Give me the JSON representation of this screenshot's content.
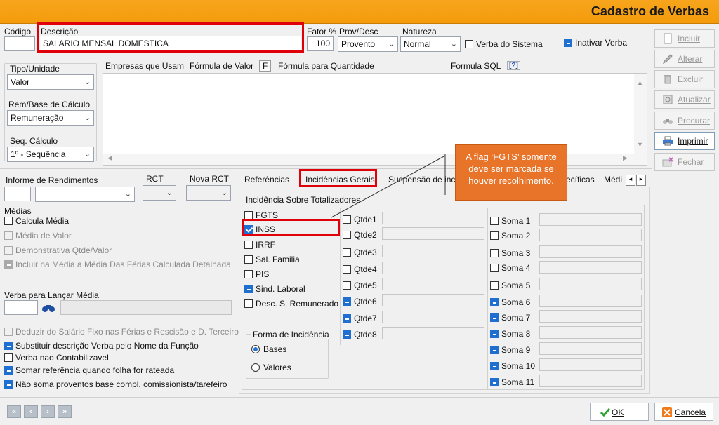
{
  "window": {
    "title": "Cadastro de Verbas"
  },
  "header": {
    "codigo_label": "Código",
    "descricao_label": "Descrição",
    "descricao_value": "SALARIO MENSAL DOMESTICA",
    "fator_label": "Fator %",
    "fator_value": "100",
    "provdesc_label": "Prov/Desc",
    "provdesc_value": "Provento",
    "natureza_label": "Natureza",
    "natureza_value": "Normal",
    "verba_sistema_label": "Verba do Sistema",
    "inativar_label": "Inativar Verba"
  },
  "left_top": {
    "tipo_label": "Tipo/Unidade",
    "tipo_value": "Valor",
    "rem_label": "Rem/Base de Cálculo",
    "rem_value": "Remuneração",
    "seq_label": "Seq. Cálculo",
    "seq_value": "1º - Sequência"
  },
  "top_tabs": {
    "empresas": "Empresas que Usam",
    "formula_valor": "Fórmula de Valor",
    "f_btn": "F",
    "formula_qtd": "Fórmula para Quantidade",
    "formula_sql": "Formula SQL",
    "sql_help": "[?]"
  },
  "side_buttons": [
    {
      "label": "Incluir",
      "icon": "page-icon",
      "active": false
    },
    {
      "label": "Alterar",
      "icon": "pencil-icon",
      "active": false
    },
    {
      "label": "Excluir",
      "icon": "trash-icon",
      "active": false
    },
    {
      "label": "Atualizar",
      "icon": "refresh-icon",
      "active": false
    },
    {
      "label": "Procurar",
      "icon": "binoculars-icon",
      "active": false
    },
    {
      "label": "Imprimir",
      "icon": "printer-icon",
      "active": true
    },
    {
      "label": "Fechar",
      "icon": "close-folder-icon",
      "active": false
    }
  ],
  "left_bottom": {
    "informe_label": "Informe de Rendimentos",
    "rct_label": "RCT",
    "nova_rct_label": "Nova RCT",
    "medias_label": "Médias",
    "calcula_media": "Calcula Média",
    "media_valor": "Média de Valor",
    "demonstrativa": "Demonstrativa Qtde/Valor",
    "incluir_media": "Incluir na Média a Média Das Férias Calculada Detalhada",
    "verba_lancar_label": "Verba para Lançar Média",
    "deduzir": "Deduzir do Salário Fixo nas  Férias e Rescisão e D. Terceiro",
    "substituir": "Substituir descrição Verba pelo Nome da Função",
    "nao_contabilizavel": "Verba nao Contabilizavel",
    "somar_referencia": "Somar referência quando folha for rateada",
    "nao_soma": "Não soma proventos base compl. comissionista/tarefeiro"
  },
  "bottom_tabs": {
    "referencias": "Referências",
    "incidencias": "Incidências Gerais",
    "suspensao": "Suspensão de inc",
    "especificas": "ecíficas",
    "media": "Médi"
  },
  "incidencias": {
    "group_label": "Incidência Sobre Totalizadores",
    "items": [
      {
        "label": "FGTS",
        "state": "off"
      },
      {
        "label": "INSS",
        "state": "checked"
      },
      {
        "label": "IRRF",
        "state": "off"
      },
      {
        "label": "Sal. Familia",
        "state": "off"
      },
      {
        "label": "PIS",
        "state": "off"
      },
      {
        "label": "Sind. Laboral",
        "state": "on"
      },
      {
        "label": "Desc. S. Remunerado",
        "state": "off"
      }
    ],
    "forma_label": "Forma de Incidência",
    "bases": "Bases",
    "valores": "Valores",
    "qtde": [
      {
        "label": "Qtde1",
        "state": "off"
      },
      {
        "label": "Qtde2",
        "state": "off"
      },
      {
        "label": "Qtde3",
        "state": "off"
      },
      {
        "label": "Qtde4",
        "state": "off"
      },
      {
        "label": "Qtde5",
        "state": "off"
      },
      {
        "label": "Qtde6",
        "state": "on"
      },
      {
        "label": "Qtde7",
        "state": "on"
      },
      {
        "label": "Qtde8",
        "state": "on"
      }
    ],
    "soma": [
      {
        "label": "Soma 1",
        "state": "off"
      },
      {
        "label": "Soma 2",
        "state": "off"
      },
      {
        "label": "Soma 3",
        "state": "off"
      },
      {
        "label": "Soma 4",
        "state": "off"
      },
      {
        "label": "Soma 5",
        "state": "off"
      },
      {
        "label": "Soma 6",
        "state": "on"
      },
      {
        "label": "Soma 7",
        "state": "on"
      },
      {
        "label": "Soma 8",
        "state": "on"
      },
      {
        "label": "Soma 9",
        "state": "on"
      },
      {
        "label": "Soma 10",
        "state": "on"
      },
      {
        "label": "Soma 11",
        "state": "on"
      }
    ]
  },
  "callout": {
    "text": "A flag ‘FGTS’ somente deve ser marcada se houver recolhimento."
  },
  "footer": {
    "ok": "OK",
    "cancel": "Cancela"
  },
  "colors": {
    "accent": "#f49b0c",
    "highlight": "#e0000a",
    "callout": "#e8742a",
    "check": "#1f6fd0"
  }
}
